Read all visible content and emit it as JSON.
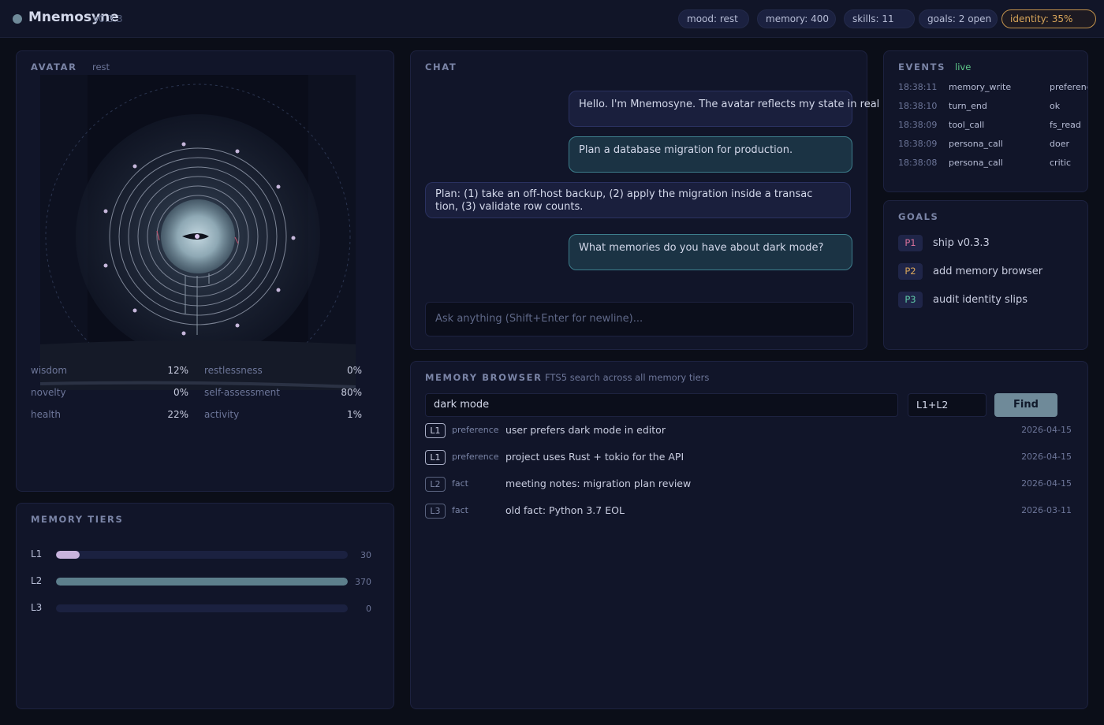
{
  "app": {
    "title": "Mnemosyne",
    "version": "v0.3.3"
  },
  "pills": {
    "mood": "mood: rest",
    "memory": "memory: 400",
    "skills": "skills: 11",
    "goals": "goals: 2 open",
    "identity": "identity: 35%"
  },
  "avatar": {
    "title": "AVATAR",
    "state": "rest",
    "stats": {
      "wisdom": {
        "label": "wisdom",
        "value": "12%"
      },
      "novelty": {
        "label": "novelty",
        "value": "0%"
      },
      "health": {
        "label": "health",
        "value": "22%"
      },
      "restlessness": {
        "label": "restlessness",
        "value": "0%"
      },
      "self_assessment": {
        "label": "self-assessment",
        "value": "80%"
      },
      "activity": {
        "label": "activity",
        "value": "1%"
      }
    }
  },
  "memory_tiers": {
    "title": "MEMORY TIERS",
    "tiers": [
      {
        "label": "L1",
        "count": "30",
        "fraction": 0.081,
        "color": "#c8b3dc"
      },
      {
        "label": "L2",
        "count": "370",
        "fraction": 1.0,
        "color": "#5d7f8c"
      },
      {
        "label": "L3",
        "count": "0",
        "fraction": 0,
        "color": "#5d7f8c"
      }
    ]
  },
  "chat": {
    "title": "CHAT",
    "messages": [
      {
        "role": "assistant",
        "text": "Hello. I'm Mnemosyne. The avatar reflects my state in real"
      },
      {
        "role": "user",
        "text": "Plan a database migration for production."
      },
      {
        "role": "assistant",
        "text": "Plan: (1) take an off-host backup, (2) apply the migration inside a transac\ntion, (3) validate row counts."
      },
      {
        "role": "user",
        "text": "What memories do you have about dark mode?"
      }
    ],
    "input_placeholder": "Ask anything (Shift+Enter for newline)..."
  },
  "events": {
    "title": "EVENTS",
    "status": "live",
    "rows": [
      {
        "time": "18:38:11",
        "type": "memory_write",
        "detail": "preference"
      },
      {
        "time": "18:38:10",
        "type": "turn_end",
        "detail": "ok"
      },
      {
        "time": "18:38:09",
        "type": "tool_call",
        "detail": "fs_read"
      },
      {
        "time": "18:38:09",
        "type": "persona_call",
        "detail": "doer"
      },
      {
        "time": "18:38:08",
        "type": "persona_call",
        "detail": "critic"
      }
    ]
  },
  "goals": {
    "title": "GOALS",
    "items": [
      {
        "priority": "P1",
        "label": "ship v0.3.3",
        "color": "#d8719a"
      },
      {
        "priority": "P2",
        "label": "add memory browser",
        "color": "#d9a65a"
      },
      {
        "priority": "P3",
        "label": "audit identity slips",
        "color": "#5fc9a8"
      }
    ]
  },
  "memory_browser": {
    "title": "MEMORY BROWSER",
    "subtitle": "FTS5 search across all memory tiers",
    "query": "dark mode",
    "tier_filter": "L1+L2",
    "find_label": "Find",
    "results": [
      {
        "tier": "L1",
        "kind": "preference",
        "text": "user prefers dark mode in editor",
        "date": "2026-04-15"
      },
      {
        "tier": "L1",
        "kind": "preference",
        "text": "project uses Rust + tokio for the API",
        "date": "2026-04-15"
      },
      {
        "tier": "L2",
        "kind": "fact",
        "text": "meeting notes: migration plan review",
        "date": "2026-04-15"
      },
      {
        "tier": "L3",
        "kind": "fact",
        "text": "old fact: Python 3.7 EOL",
        "date": "2026-03-11"
      }
    ]
  }
}
